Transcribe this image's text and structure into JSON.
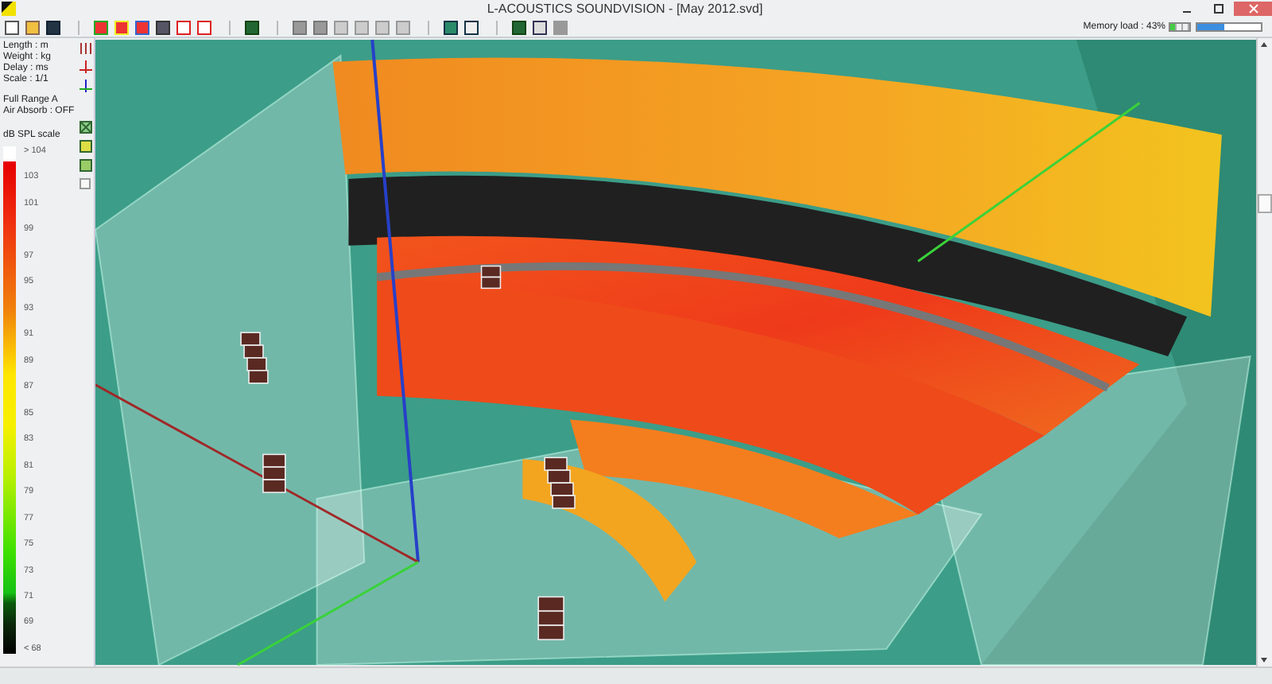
{
  "window": {
    "title": "L-ACOUSTICS SOUNDVISION - [May 2012.svd]"
  },
  "memory": {
    "label": "Memory load : 43%",
    "level": 0.43
  },
  "units": [
    "Length : m",
    "Weight : kg",
    "Delay : ms",
    "Scale : 1/1"
  ],
  "mode": [
    "Full Range A",
    "Air Absorb : OFF"
  ],
  "scale": {
    "title": "dB SPL scale",
    "labels": [
      "> 104",
      "103",
      "101",
      "99",
      "97",
      "95",
      "93",
      "91",
      "89",
      "87",
      "85",
      "83",
      "81",
      "79",
      "77",
      "75",
      "73",
      "71",
      "69",
      "< 68"
    ]
  }
}
